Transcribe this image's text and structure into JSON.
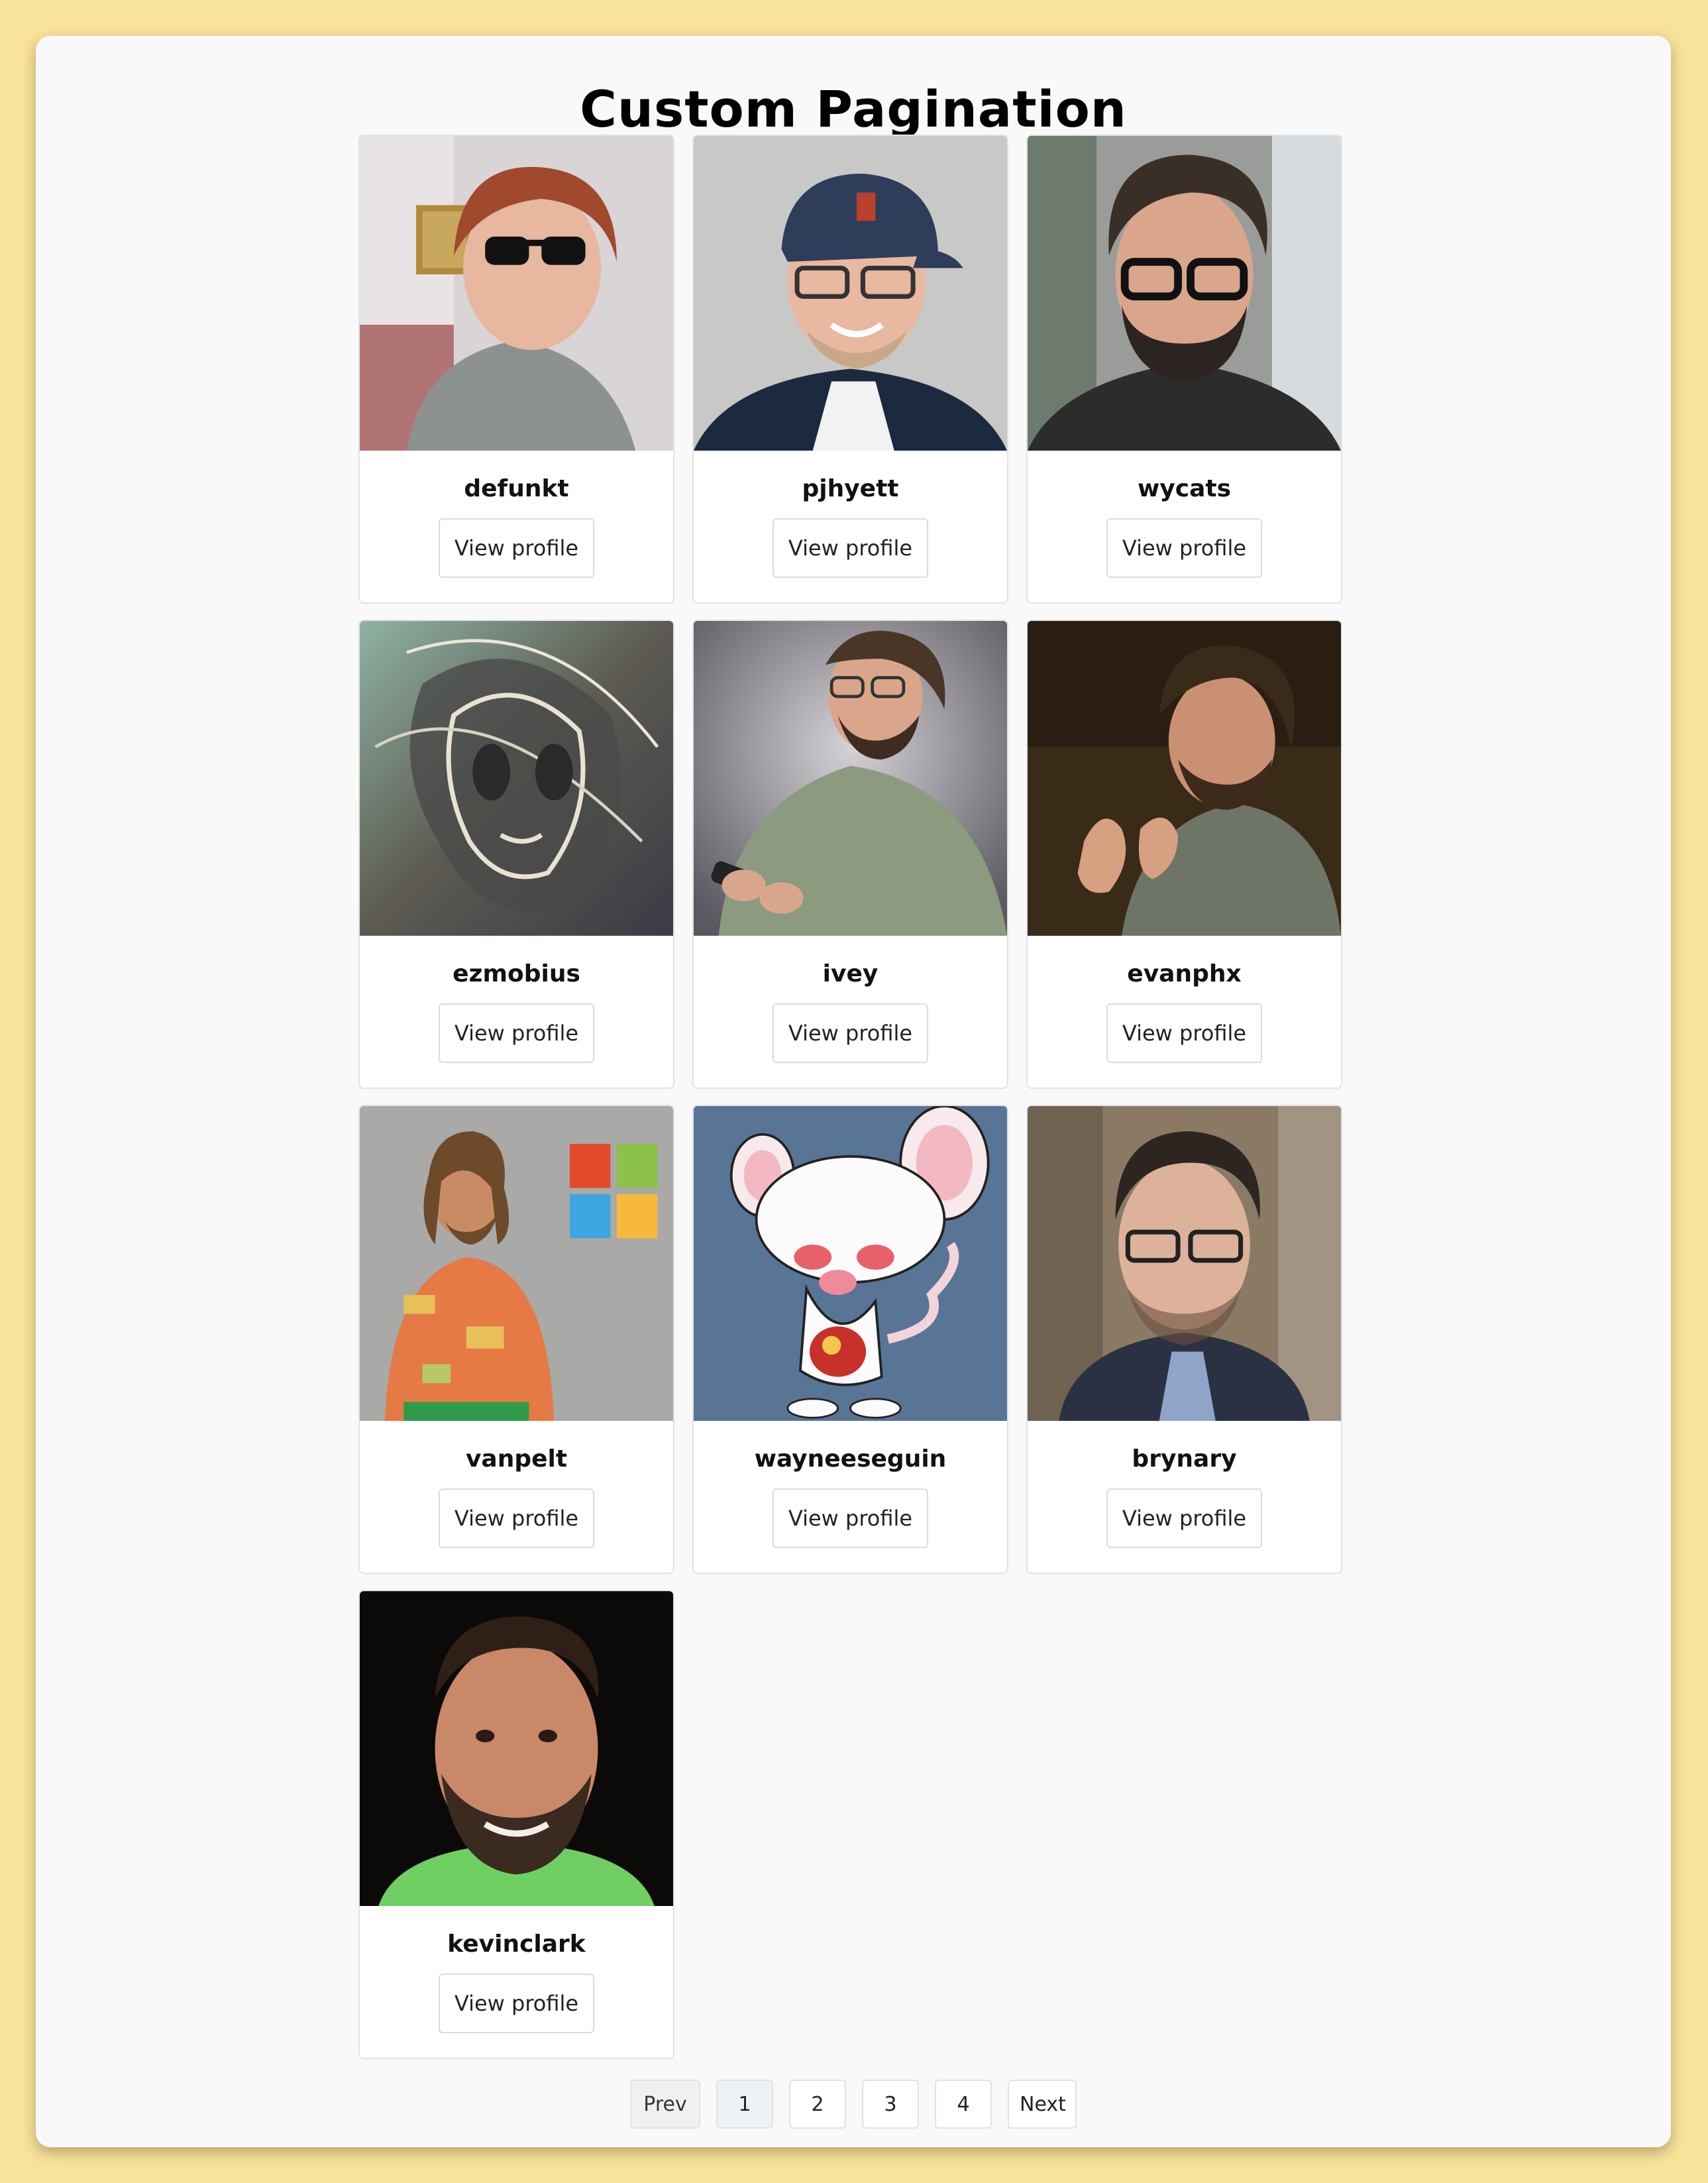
{
  "page": {
    "title": "Custom Pagination",
    "background_color": "#f9e39a",
    "panel_color": "#f9f9f9"
  },
  "users": [
    {
      "username": "defunkt",
      "button": "View profile"
    },
    {
      "username": "pjhyett",
      "button": "View profile"
    },
    {
      "username": "wycats",
      "button": "View profile"
    },
    {
      "username": "ezmobius",
      "button": "View profile"
    },
    {
      "username": "ivey",
      "button": "View profile"
    },
    {
      "username": "evanphx",
      "button": "View profile"
    },
    {
      "username": "vanpelt",
      "button": "View profile"
    },
    {
      "username": "wayneeseguin",
      "button": "View profile"
    },
    {
      "username": "brynary",
      "button": "View profile"
    },
    {
      "username": "kevinclark",
      "button": "View profile"
    }
  ],
  "pagination": {
    "prev_label": "Prev",
    "next_label": "Next",
    "pages": [
      "1",
      "2",
      "3",
      "4"
    ],
    "current_page": "1"
  }
}
